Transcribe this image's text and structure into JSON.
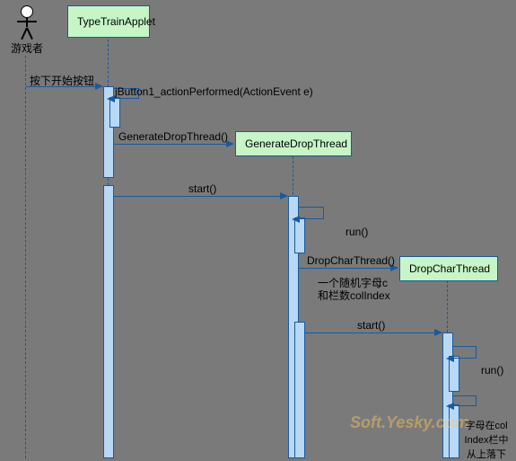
{
  "actor": {
    "label": "游戏者"
  },
  "lifelines": {
    "typeTrainApplet": "TypeTrainApplet",
    "generateDropThread": "GenerateDropThread",
    "dropCharThread": "DropCharThread"
  },
  "messages": {
    "pressStart": "按下开始按钮",
    "actionPerformed": "jButton1_actionPerformed(ActionEvent e)",
    "generateDropThread": "GenerateDropThread()",
    "start1": "start()",
    "run1": "run()",
    "dropCharThread": "DropCharThread()",
    "note1a": "一个随机字母c",
    "note1b": "和栏数colIndex",
    "start2": "start()",
    "run2": "run()"
  },
  "watermark": "Soft.Yesky.com",
  "bottomNote": {
    "l1": "字母在col",
    "l2": "Index栏中",
    "l3": "从上落下"
  }
}
